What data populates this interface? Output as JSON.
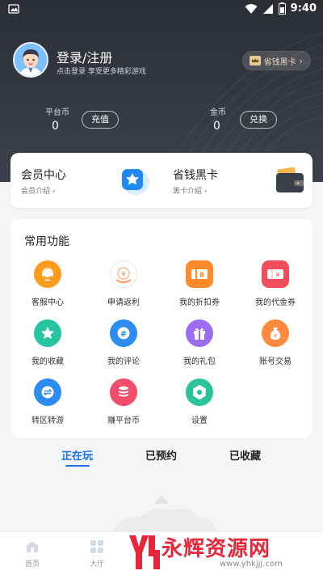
{
  "status": {
    "time": "9:40"
  },
  "header": {
    "login_title": "登录/注册",
    "login_sub": "点击登录 享受更多精彩游戏",
    "vip_label": "省钱黑卡"
  },
  "coins": {
    "platform": {
      "label": "平台币",
      "value": "0",
      "button": "充值"
    },
    "gold": {
      "label": "金币",
      "value": "0",
      "button": "兑换"
    }
  },
  "member": {
    "center_title": "会员中心",
    "center_sub": "会员介绍",
    "card_title": "省钱黑卡",
    "card_sub": "黑卡介绍"
  },
  "functions": {
    "title": "常用功能",
    "items": [
      {
        "label": "客服中心",
        "icon": "customer-service-icon",
        "color": "#ff9c1a"
      },
      {
        "label": "申请返利",
        "icon": "rebate-icon",
        "color": "#ffffff"
      },
      {
        "label": "我的折扣券",
        "icon": "discount-coupon-icon",
        "color": "#ff8a2a"
      },
      {
        "label": "我的代金券",
        "icon": "voucher-icon",
        "color": "#f24d5a"
      },
      {
        "label": "我的收藏",
        "icon": "star-icon",
        "color": "#27c4a2"
      },
      {
        "label": "我的评论",
        "icon": "comment-icon",
        "color": "#2d8cf0"
      },
      {
        "label": "我的礼包",
        "icon": "gift-icon",
        "color": "#9b6cf2"
      },
      {
        "label": "账号交易",
        "icon": "money-bag-icon",
        "color": "#ff8a3d"
      },
      {
        "label": "转区转游",
        "icon": "transfer-icon",
        "color": "#2d8cf0"
      },
      {
        "label": "赚平台币",
        "icon": "coin-stack-icon",
        "color": "#f24d6a"
      },
      {
        "label": "设置",
        "icon": "settings-icon",
        "color": "#2bc39a"
      }
    ]
  },
  "tabs": [
    "正在玩",
    "已预约",
    "已收藏"
  ],
  "bottom_nav": [
    "首页",
    "大厅"
  ],
  "watermark": {
    "text": "永辉资源网",
    "url": "www.yhkjjj.com"
  }
}
